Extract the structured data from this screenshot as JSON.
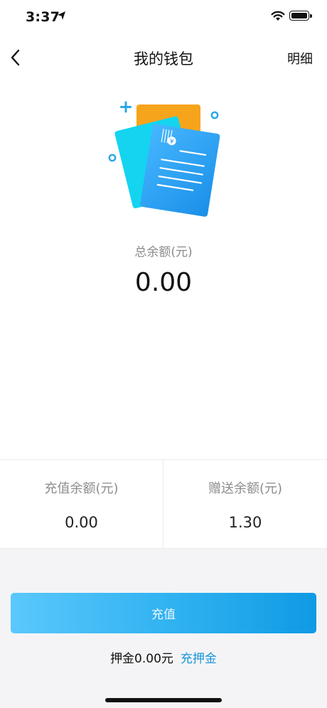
{
  "status_bar": {
    "time": "3:37"
  },
  "nav": {
    "title": "我的钱包",
    "detail_label": "明细"
  },
  "total": {
    "label": "总余额(元)",
    "value": "0.00"
  },
  "cards": [
    {
      "label": "充值余额(元)",
      "value": "0.00"
    },
    {
      "label": "赠送余额(元)",
      "value": "1.30"
    }
  ],
  "recharge_button": {
    "label": "充值"
  },
  "deposit": {
    "text": "押金0.00元",
    "link": "充押金"
  },
  "colors": {
    "accent": "#1a96d8",
    "button_start": "#5ac8fc",
    "button_end": "#0f9ae4"
  },
  "icons": [
    "location-arrow-icon",
    "wifi-icon",
    "battery-icon",
    "back-chevron-icon",
    "wallet-illustration"
  ]
}
